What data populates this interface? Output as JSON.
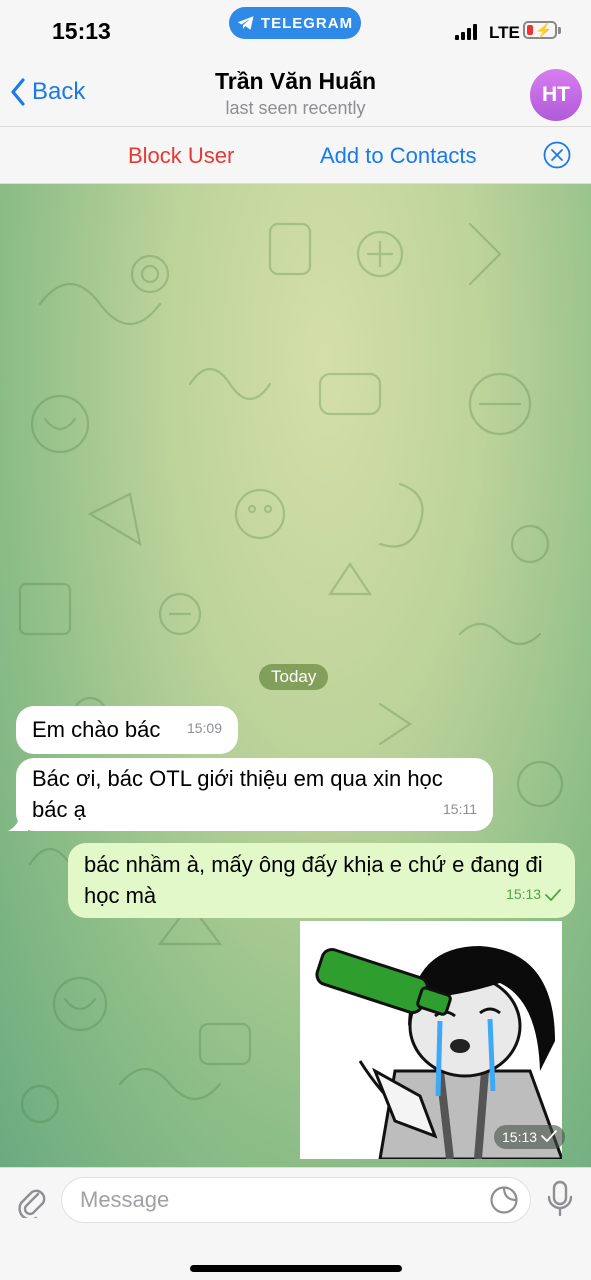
{
  "status_bar": {
    "time": "15:13",
    "app_pill": "TELEGRAM",
    "network": "LTE"
  },
  "nav": {
    "back_label": "Back",
    "title": "Trần Văn Huấn",
    "subtitle": "last seen recently",
    "avatar_initials": "HT"
  },
  "actions": {
    "block_label": "Block User",
    "add_label": "Add to Contacts"
  },
  "chat": {
    "date_label": "Today",
    "messages": [
      {
        "direction": "incoming",
        "text": "Em chào bác",
        "time": "15:09"
      },
      {
        "direction": "incoming",
        "text": "Bác ơi, bác OTL giới thiệu em qua xin học bác ạ",
        "time": "15:11"
      },
      {
        "direction": "outgoing",
        "text": "bác nhầm à, mấy ông đấy khịa e chứ e đang đi học mà",
        "time": "15:13",
        "status": "sent"
      },
      {
        "direction": "outgoing",
        "type": "sticker",
        "time": "15:13",
        "status": "sent"
      }
    ]
  },
  "composer": {
    "placeholder": "Message"
  },
  "colors": {
    "accent": "#1a7ae6",
    "danger": "#e53935",
    "outgoing_bubble": "#e3f8c8",
    "avatar": "#c46ae6"
  }
}
